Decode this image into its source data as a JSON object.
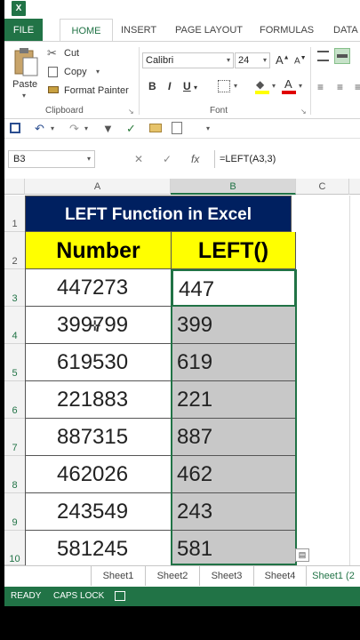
{
  "app": {
    "logo": "X"
  },
  "ribbon_tabs": [
    "FILE",
    "HOME",
    "INSERT",
    "PAGE LAYOUT",
    "FORMULAS",
    "DATA"
  ],
  "clipboard": {
    "paste": "Paste",
    "cut": "Cut",
    "copy": "Copy",
    "format_painter": "Format Painter",
    "label": "Clipboard"
  },
  "font": {
    "name": "Calibri",
    "size": "24",
    "grow": "A",
    "shrink": "A",
    "bold": "B",
    "italic": "I",
    "underline": "U",
    "label": "Font"
  },
  "formula_bar": {
    "name_box": "B3",
    "fx": "fx",
    "formula": "=LEFT(A3,3)"
  },
  "columns": [
    "A",
    "B",
    "C"
  ],
  "rows": [
    "1",
    "2",
    "3",
    "4",
    "5",
    "6",
    "7",
    "8",
    "9",
    "10"
  ],
  "sheet": {
    "title": "LEFT Function in Excel",
    "header_number": "Number",
    "header_left": "LEFT()",
    "numbers": [
      "447273",
      "399799",
      "619530",
      "221883",
      "887315",
      "462026",
      "243549",
      "581245"
    ],
    "lefts": [
      "447",
      "399",
      "619",
      "221",
      "887",
      "462",
      "243",
      "581"
    ]
  },
  "sheet_tabs": [
    "Sheet1",
    "Sheet2",
    "Sheet3",
    "Sheet4",
    "Sheet1 (2"
  ],
  "status": {
    "ready": "READY",
    "caps": "CAPS LOCK"
  },
  "colors": {
    "excel_green": "#217346",
    "title_fill": "#002060",
    "header_fill": "#ffff00",
    "selection_fill": "#c8c8c8"
  }
}
